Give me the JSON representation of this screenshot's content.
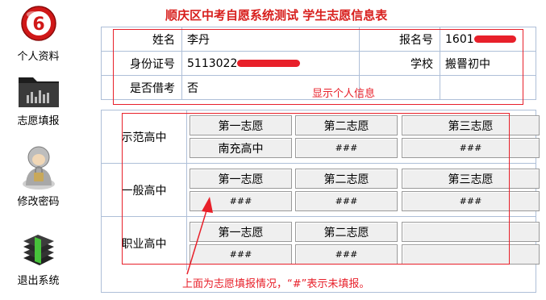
{
  "sidebar": {
    "items": [
      {
        "label": "个人资料",
        "icon": "profile-icon"
      },
      {
        "label": "志愿填报",
        "icon": "folder-icon"
      },
      {
        "label": "修改密码",
        "icon": "user-lock-icon"
      },
      {
        "label": "退出系统",
        "icon": "exit-books-icon"
      }
    ]
  },
  "page": {
    "title": "顺庆区中考自愿系统测试 学生志愿信息表"
  },
  "info": {
    "name_label": "姓名",
    "name_value": "李丹",
    "regno_label": "报名号",
    "regno_value": "1601",
    "id_label": "身份证号",
    "id_value": "5113022",
    "school_label": "学校",
    "school_value": "搬罾初中",
    "borrow_label": "是否借考",
    "borrow_value": "否",
    "annotation": "显示个人信息"
  },
  "choices": {
    "rows": [
      {
        "label": "示范高中",
        "headers": [
          "第一志愿",
          "第二志愿",
          "第三志愿"
        ],
        "values": [
          "南充高中",
          "###",
          "###"
        ]
      },
      {
        "label": "一般高中",
        "headers": [
          "第一志愿",
          "第二志愿",
          "第三志愿"
        ],
        "values": [
          "###",
          "###",
          "###"
        ]
      },
      {
        "label": "职业高中",
        "headers": [
          "第一志愿",
          "第二志愿",
          ""
        ],
        "values": [
          "###",
          "###",
          ""
        ]
      }
    ],
    "annotation": "上面为志愿填报情况，“#”表示未填报。"
  },
  "colors": {
    "accent_red": "#d8201e",
    "border_blue": "#aebfd8"
  }
}
